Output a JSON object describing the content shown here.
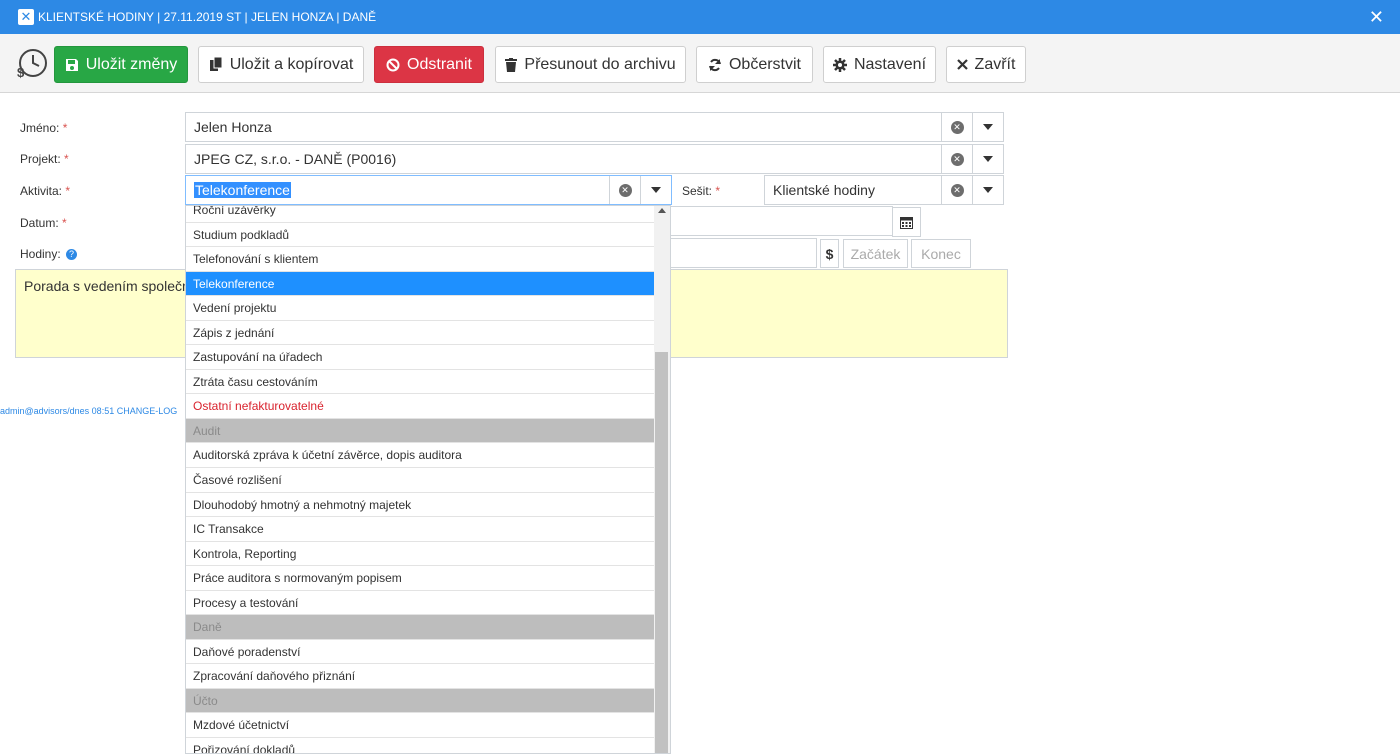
{
  "window": {
    "title": "KLIENTSKÉ HODINY | 27.11.2019 ST | JELEN HONZA | DANĚ",
    "close_label": "✕"
  },
  "toolbar": {
    "save_label": "Uložit změny",
    "save_copy_label": "Uložit a kopírovat",
    "delete_label": "Odstranit",
    "archive_label": "Přesunout do archivu",
    "refresh_label": "Občerstvit",
    "settings_label": "Nastavení",
    "close_label": "Zavřít"
  },
  "form": {
    "name_label": "Jméno:",
    "name_value": "Jelen Honza",
    "project_label": "Projekt:",
    "project_value": "JPEG CZ, s.r.o. - DANĚ (P0016)",
    "activity_label": "Aktivita:",
    "activity_value": "Telekonference",
    "workbook_label": "Sešit:",
    "workbook_value": "Klientské hodiny",
    "date_label": "Datum:",
    "hours_label": "Hodiny:",
    "required_mark": "*",
    "start_placeholder": "Začátek",
    "end_placeholder": "Konec",
    "currency_symbol": "$",
    "note_value": "Porada s vedením společn"
  },
  "dropdown": {
    "items": [
      {
        "label": "Roční uzávěrky",
        "kind": "normal"
      },
      {
        "label": "Studium podkladů",
        "kind": "normal"
      },
      {
        "label": "Telefonování s klientem",
        "kind": "normal"
      },
      {
        "label": "Telekonference",
        "kind": "selected"
      },
      {
        "label": "Vedení projektu",
        "kind": "normal"
      },
      {
        "label": "Zápis z jednání",
        "kind": "normal"
      },
      {
        "label": "Zastupování na úřadech",
        "kind": "normal"
      },
      {
        "label": "Ztráta času cestováním",
        "kind": "normal"
      },
      {
        "label": "Ostatní nefakturovatelné",
        "kind": "red"
      },
      {
        "label": "Audit",
        "kind": "group"
      },
      {
        "label": "Auditorská zpráva k účetní závěrce, dopis auditora",
        "kind": "normal"
      },
      {
        "label": "Časové rozlišení",
        "kind": "normal"
      },
      {
        "label": "Dlouhodobý hmotný a nehmotný majetek",
        "kind": "normal"
      },
      {
        "label": "IC Transakce",
        "kind": "normal"
      },
      {
        "label": "Kontrola, Reporting",
        "kind": "normal"
      },
      {
        "label": "Práce auditora s normovaným popisem",
        "kind": "normal"
      },
      {
        "label": "Procesy a testování",
        "kind": "normal"
      },
      {
        "label": "Daně",
        "kind": "group"
      },
      {
        "label": "Daňové poradenství",
        "kind": "normal"
      },
      {
        "label": "Zpracování daňového přiznání",
        "kind": "normal"
      },
      {
        "label": "Účto",
        "kind": "group"
      },
      {
        "label": "Mzdové účetnictví",
        "kind": "normal"
      },
      {
        "label": "Pořizování dokladů",
        "kind": "normal"
      }
    ]
  },
  "footer": {
    "log_text": "admin@advisors/dnes 08:51 CHANGE-LOG"
  },
  "colors": {
    "titlebar": "#2d89e5",
    "save": "#28a745",
    "delete": "#dc3545",
    "selected_item": "#1e90ff",
    "group_item": "#bdbdbd",
    "note_background": "#ffffcc"
  },
  "icons": [
    "close-icon",
    "history-icon",
    "save-icon",
    "copy-icon",
    "ban-icon",
    "trash-icon",
    "refresh-icon",
    "gear-icon",
    "times-icon",
    "calendar-icon",
    "help-icon"
  ]
}
